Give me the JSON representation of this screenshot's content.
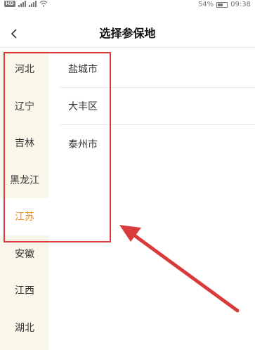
{
  "status_bar": {
    "hd_label": "HD",
    "network_1": "2G",
    "network_2": "4G",
    "battery_percent": "54%",
    "time": "09:38"
  },
  "header": {
    "title": "选择参保地"
  },
  "provinces": [
    {
      "label": "河北"
    },
    {
      "label": "辽宁"
    },
    {
      "label": "吉林"
    },
    {
      "label": "黑龙江"
    },
    {
      "label": "江苏",
      "selected": true
    },
    {
      "label": "安徽"
    },
    {
      "label": "江西"
    },
    {
      "label": "湖北"
    }
  ],
  "cities": [
    {
      "label": "盐城市"
    },
    {
      "label": "大丰区"
    },
    {
      "label": "泰州市"
    }
  ],
  "colors": {
    "accent": "#f08c1e",
    "province_bg": "#fbf6ea",
    "annotation": "#d93b3b"
  },
  "icons": {
    "back": "chevron-left-icon",
    "wifi": "wifi-icon",
    "battery": "battery-icon"
  }
}
